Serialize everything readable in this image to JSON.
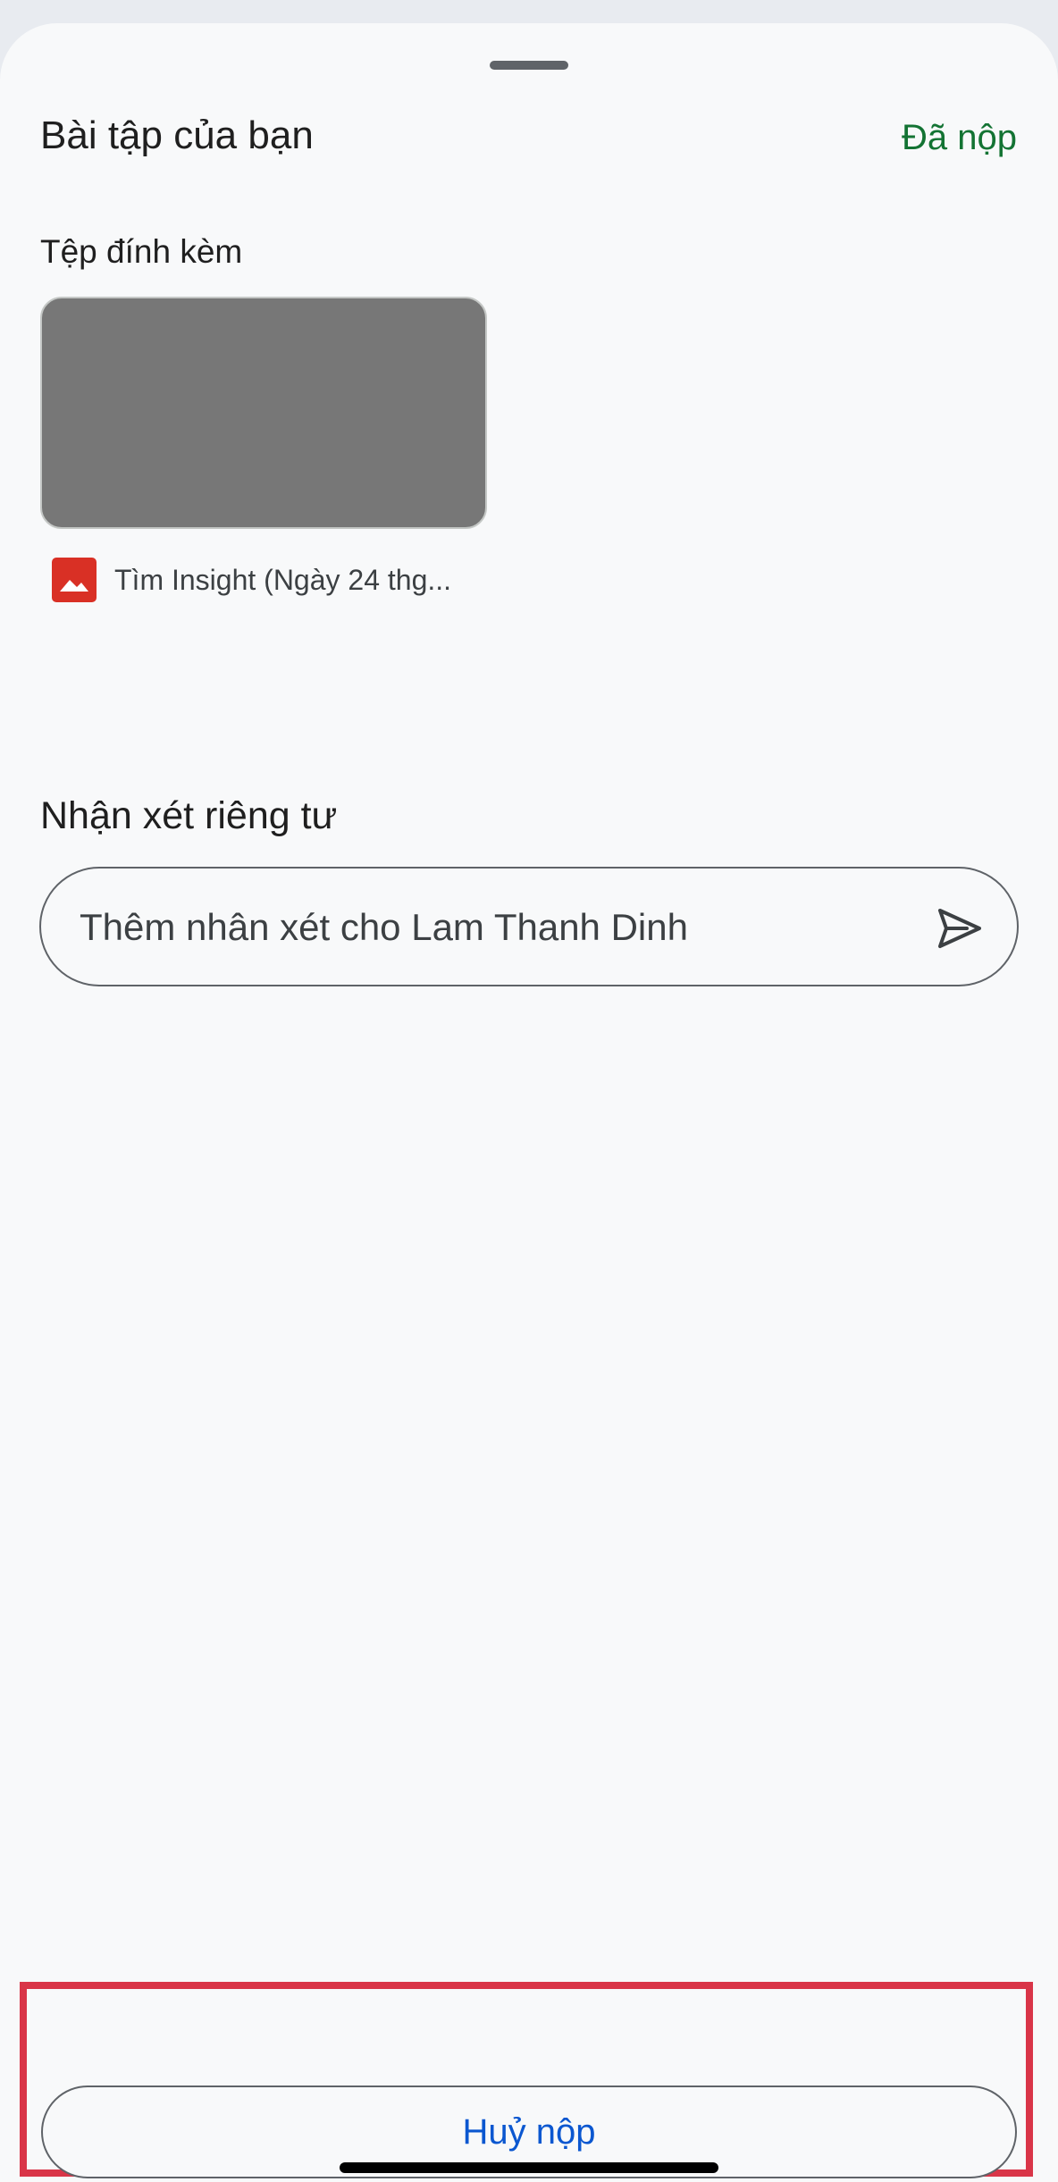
{
  "sheet": {
    "title": "Bài tập của bạn",
    "status": "Đã nộp"
  },
  "attachments": {
    "label": "Tệp đính kèm",
    "items": [
      {
        "icon": "image-file-icon",
        "name": "Tìm Insight (Ngày 24 thg..."
      }
    ]
  },
  "private_comments": {
    "title": "Nhận xét riêng tư",
    "placeholder": "Thêm nhân xét cho Lam Thanh Dinh",
    "send_icon": "send-icon"
  },
  "actions": {
    "unsubmit_label": "Huỷ nộp"
  },
  "colors": {
    "status_green": "#137333",
    "action_blue": "#0b57d0",
    "highlight_red": "#d93548",
    "file_icon_red": "#d93025",
    "thumbnail_gray": "#777777"
  }
}
